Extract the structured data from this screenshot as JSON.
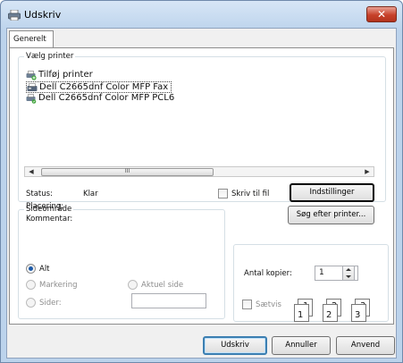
{
  "window": {
    "title": "Udskriv",
    "close_label": "✕"
  },
  "tab": {
    "label": "Generelt"
  },
  "printer_group": {
    "legend": "Vælg printer",
    "printers": [
      {
        "name": "Tilføj printer",
        "icon": "add-printer-icon"
      },
      {
        "name": "Dell C2665dnf Color MFP Fax",
        "icon": "fax-icon",
        "selected": true
      },
      {
        "name": "Dell C2665dnf Color MFP PCL6",
        "icon": "printer-icon"
      }
    ],
    "scroll_thumb_grip": "III",
    "status_label": "Status:",
    "status_value": "Klar",
    "location_label": "Placering:",
    "comment_label": "Kommentar:",
    "print_to_file_label": "Skriv til fil",
    "preferences_button": "Indstillinger",
    "find_printer_button": "Søg efter printer..."
  },
  "range_group": {
    "legend": "Sideområde",
    "all_label": "Alt",
    "selection_label": "Markering",
    "current_page_label": "Aktuel side",
    "pages_label": "Sider:"
  },
  "copies": {
    "label": "Antal kopier:",
    "value": "1",
    "collate_label": "Sætvis"
  },
  "collate_pages": [
    {
      "back": "1",
      "front": "1"
    },
    {
      "back": "2",
      "front": "2"
    },
    {
      "back": "3",
      "front": "3"
    }
  ],
  "footer": {
    "print_button": "Udskriv",
    "cancel_button": "Annuller",
    "apply_button": "Anvend"
  },
  "colors": {
    "titlebar": "#bcd3ec",
    "close_button": "#c7412a",
    "default_button_border": "#3c7fb1"
  }
}
